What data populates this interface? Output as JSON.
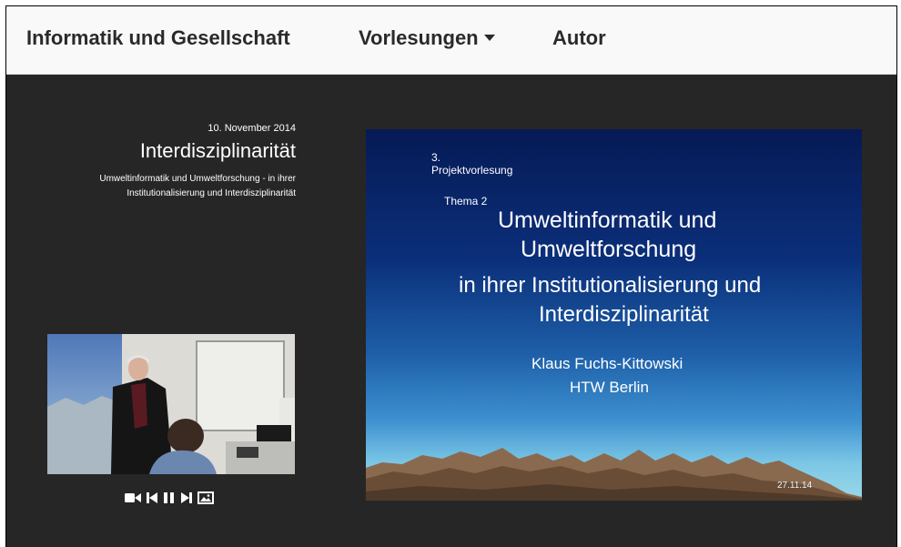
{
  "navbar": {
    "brand": "Informatik und Gesellschaft",
    "lectures_label": "Vorlesungen",
    "author_label": "Autor"
  },
  "lecture": {
    "date": "10. November 2014",
    "title": "Interdisziplinarität",
    "subtitle_line1": "Umweltinformatik und Umweltforschung - in ihrer",
    "subtitle_line2": "Institutionalisierung und Interdisziplinarität"
  },
  "player": {
    "controls": [
      "video-camera-icon",
      "step-backward-icon",
      "pause-icon",
      "step-forward-icon",
      "image-icon"
    ]
  },
  "slide": {
    "number": "3.",
    "series": "Projektvorlesung",
    "theme": "Thema 2",
    "title_line1": "Umweltinformatik und",
    "title_line2": "Umweltforschung",
    "subtitle_line1": "in ihrer Institutionalisierung und",
    "subtitle_line2": "Interdisziplinarität",
    "author": "Klaus Fuchs-Kittowski",
    "institution": "HTW Berlin",
    "date": "27.11.14"
  }
}
